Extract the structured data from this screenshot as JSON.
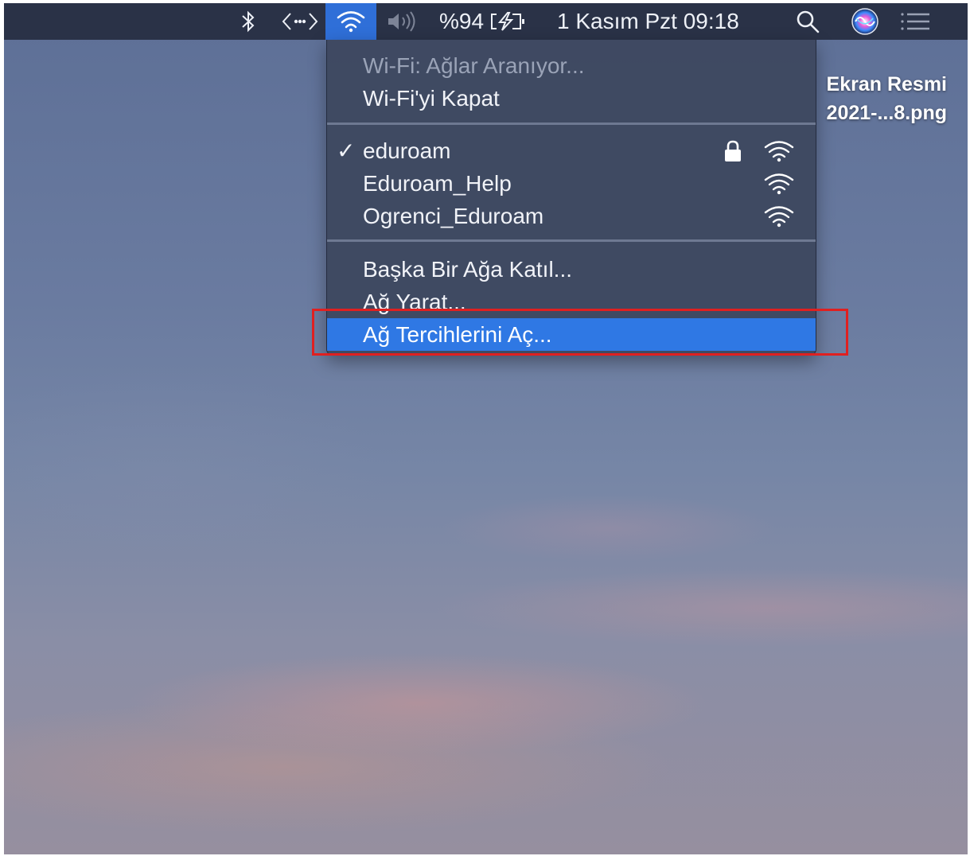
{
  "menubar": {
    "icons": [
      "bluetooth-icon",
      "code-icon",
      "wifi-icon",
      "volume-icon",
      "battery-icon",
      "search-icon",
      "siri-icon",
      "notification-center-icon"
    ],
    "battery_percent": "%94",
    "datetime": "1 Kasım Pzt  09:18"
  },
  "desktop": {
    "file_line1": "Ekran Resmi",
    "file_line2": "2021-...8.png"
  },
  "wifi_menu": {
    "status": "Wi-Fi: Ağlar Aranıyor...",
    "toggle": "Wi-Fi'yi Kapat",
    "networks": [
      {
        "name": "eduroam",
        "connected": true,
        "secured": true
      },
      {
        "name": "Eduroam_Help",
        "connected": false,
        "secured": false
      },
      {
        "name": "Ogrenci_Eduroam",
        "connected": false,
        "secured": false
      }
    ],
    "check_mark": "✓",
    "join_other": "Başka Bir Ağa Katıl...",
    "create_network": "Ağ Yarat...",
    "open_preferences": "Ağ Tercihlerini Aç..."
  },
  "colors": {
    "menubar": "#2a3247",
    "wifi_active": "#2f6fd8",
    "highlight": "#2f78e4",
    "annotation": "#e02020"
  }
}
